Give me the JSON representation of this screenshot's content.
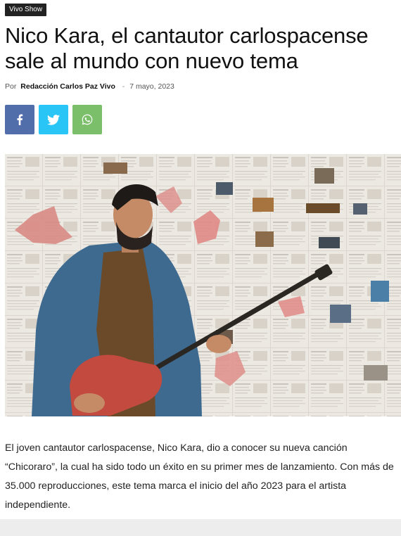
{
  "category": {
    "label": "Vivo Show"
  },
  "article": {
    "title": "Nico Kara, el cantautor carlospacense sale al mundo con nuevo tema",
    "meta": {
      "by_label": "Por",
      "author": "Redacción Carlos Paz Vivo",
      "separator": "-",
      "date": "7 mayo, 2023"
    },
    "body": "El joven cantautor carlospacense, Nico Kara, dio a conocer su nueva canción “Chicoraro”, la cual ha sido todo un éxito en su primer mes de lanzamiento. Con más de 35.000 reproducciones, este tema marca el inicio del año 2023 para el artista independiente."
  },
  "share": {
    "buttons": [
      {
        "network": "facebook",
        "icon": "facebook-icon",
        "color": "#516eab"
      },
      {
        "network": "twitter",
        "icon": "twitter-icon",
        "color": "#29c5f6"
      },
      {
        "network": "whatsapp",
        "icon": "whatsapp-icon",
        "color": "#7bbf6a"
      }
    ]
  },
  "hero_image": {
    "subject": "man with beard in denim jacket playing red bass guitar in front of newspaper-covered wall"
  }
}
